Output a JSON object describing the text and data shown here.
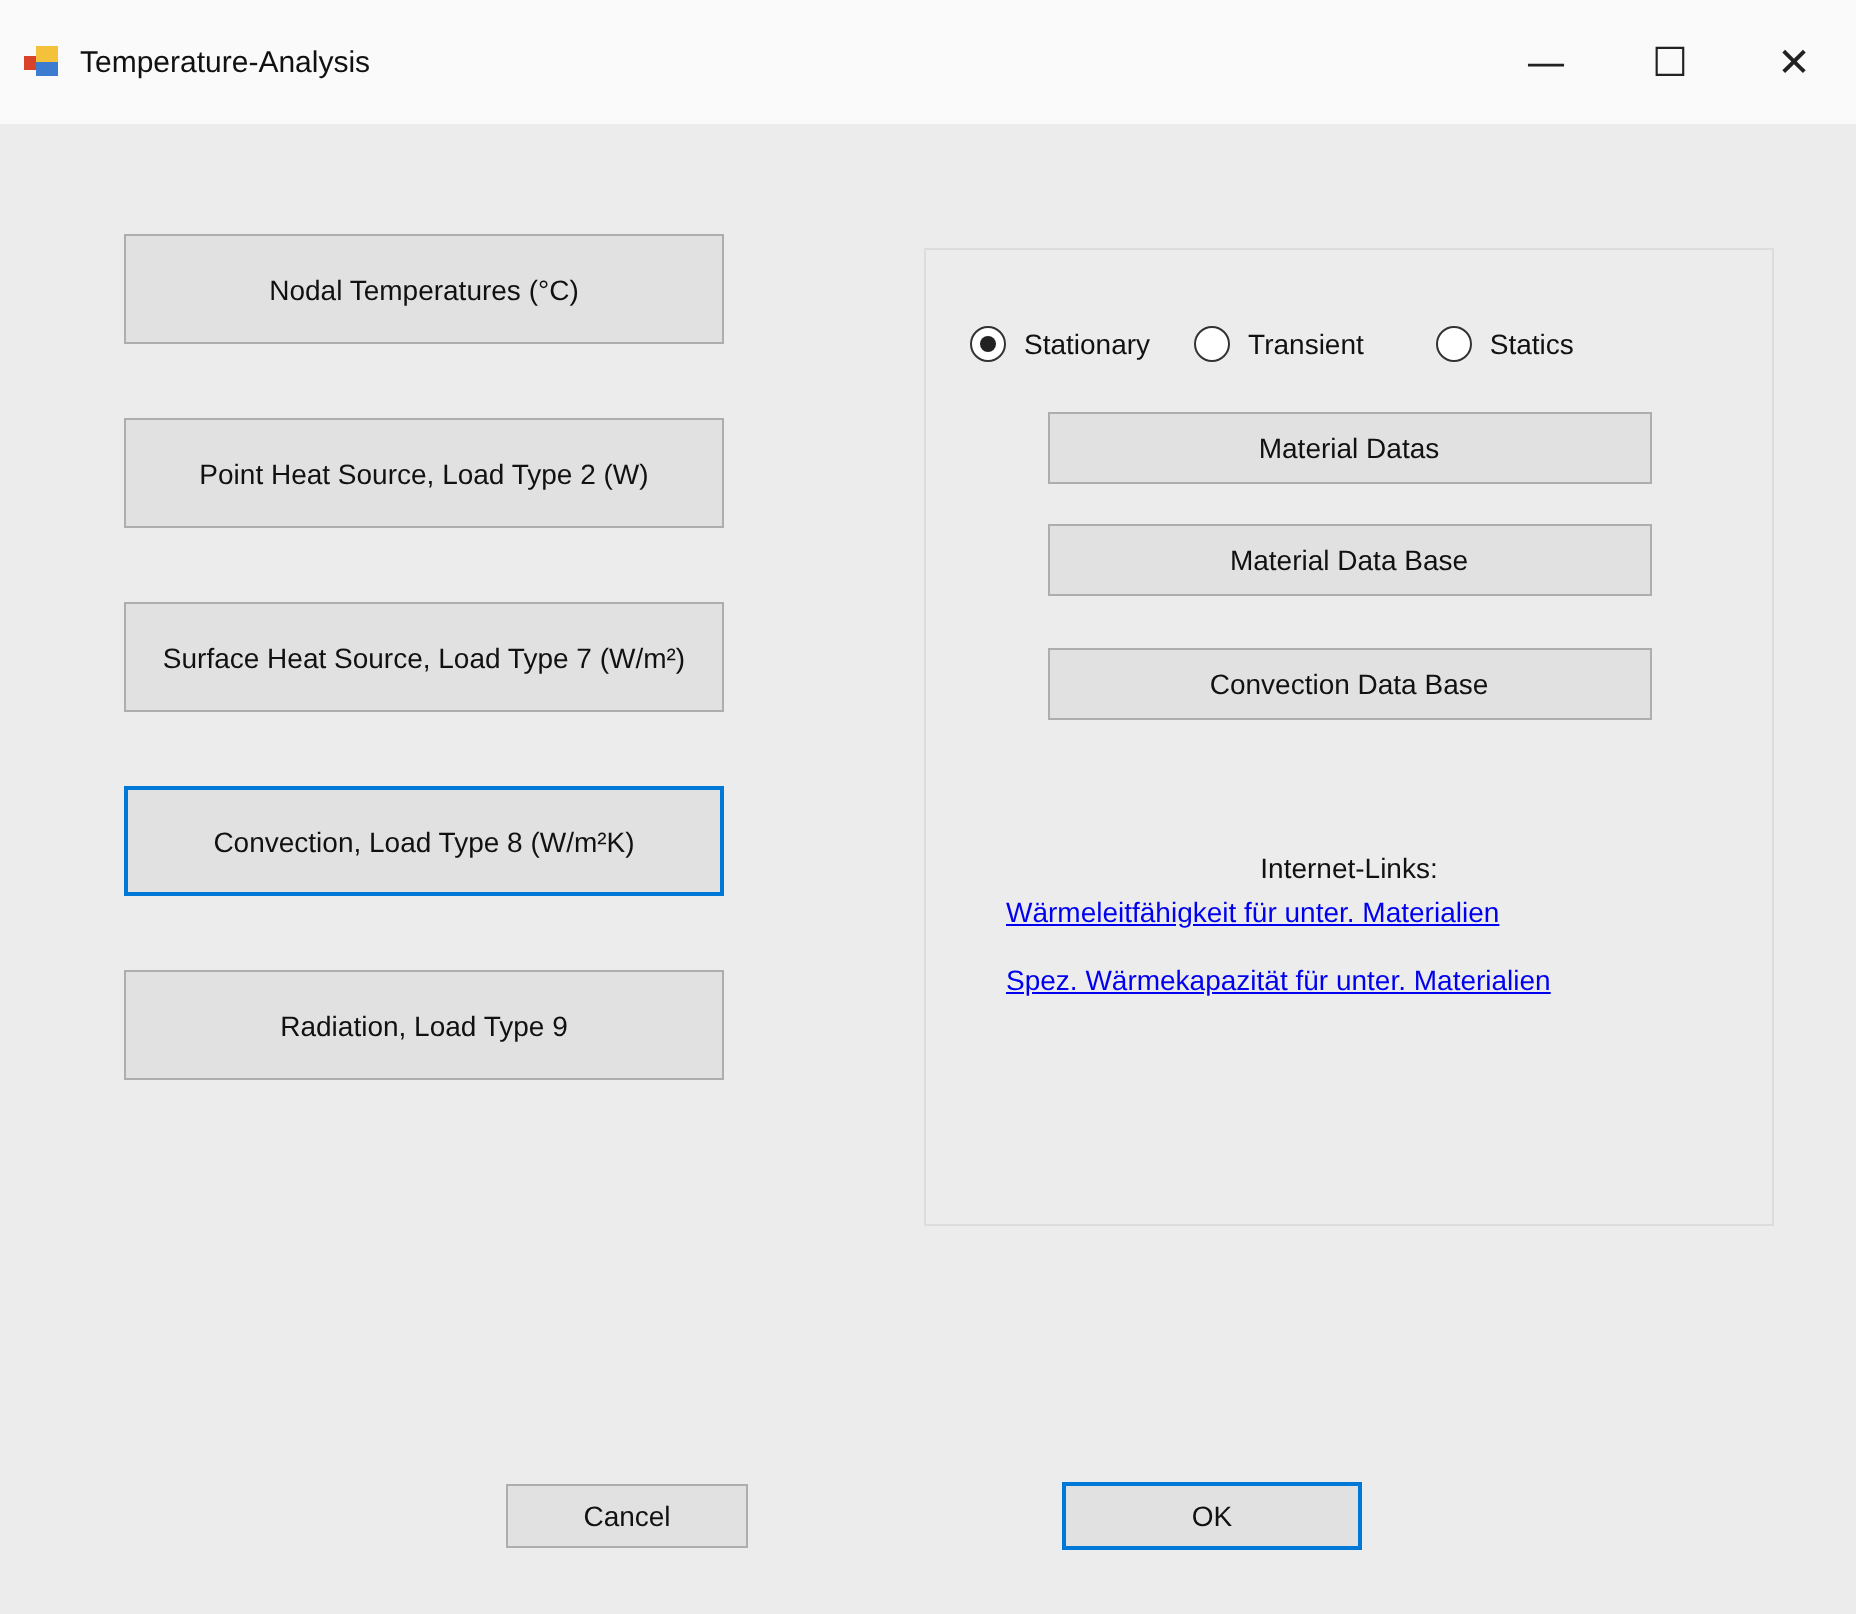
{
  "window": {
    "title": "Temperature-Analysis",
    "controls": [
      "—",
      "☐",
      "✕"
    ]
  },
  "load_buttons": [
    {
      "label": "Nodal Temperatures (°C)",
      "focused": false
    },
    {
      "label": "Point Heat Source, Load Type 2 (W)",
      "focused": false
    },
    {
      "label": "Surface Heat Source, Load Type 7 (W/m²)",
      "focused": false
    },
    {
      "label": "Convection, Load Type 8 (W/m²K)",
      "focused": true
    },
    {
      "label": "Radiation, Load Type 9",
      "focused": false
    }
  ],
  "analysis_type": [
    {
      "label": "Stationary",
      "selected": true
    },
    {
      "label": "Transient",
      "selected": false
    },
    {
      "label": "Statics",
      "selected": false
    }
  ],
  "data_buttons": [
    "Material Datas",
    "Material Data Base",
    "Convection Data Base"
  ],
  "links_heading": "Internet-Links:",
  "links": [
    "Wärmeleitfähigkeit für unter. Materialien",
    "Spez. Wärmekapazität für unter. Materialien"
  ],
  "dialog_buttons": [
    {
      "label": "Cancel",
      "focused": false
    },
    {
      "label": "OK",
      "focused": true
    }
  ]
}
